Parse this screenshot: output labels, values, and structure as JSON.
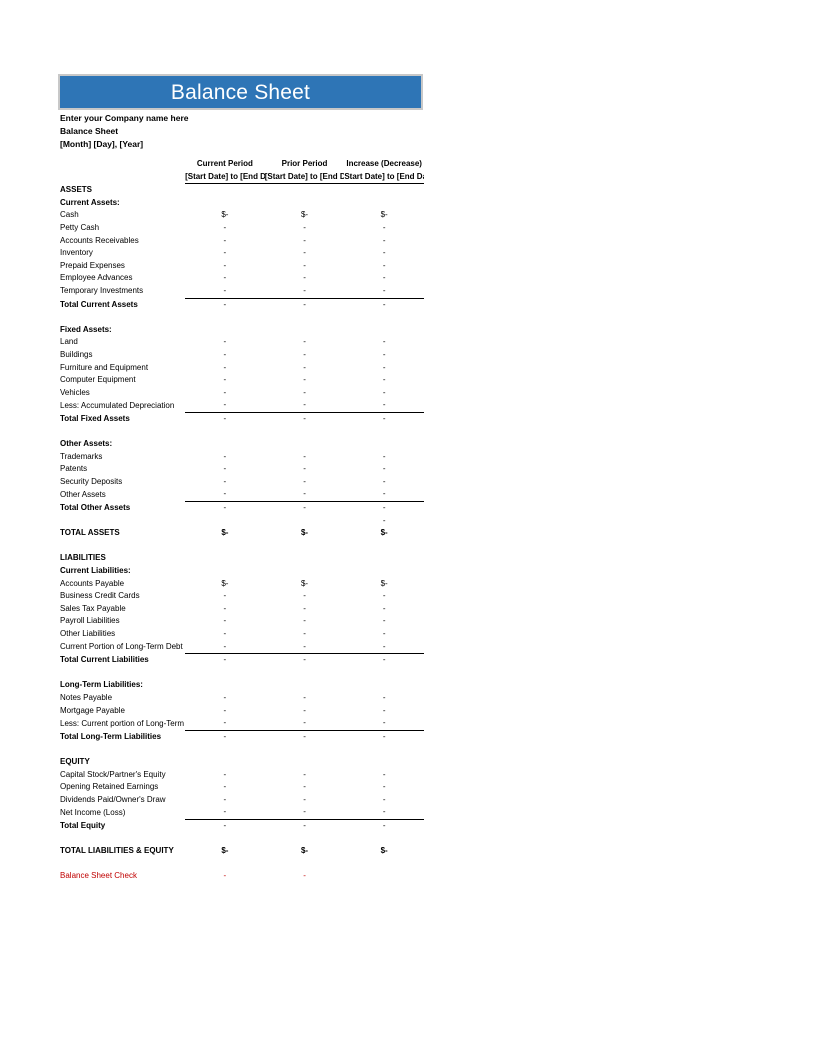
{
  "document": {
    "title": "Balance Sheet",
    "company_name": "Enter your Company name here",
    "doc_label": "Balance Sheet",
    "date_line": "[Month] [Day], [Year]"
  },
  "colors": {
    "banner_bg": "#2E75B6",
    "banner_border": "#c8c8c8",
    "banner_text": "#ffffff",
    "check_text": "#C00000"
  },
  "columns": [
    {
      "main": "Current Period",
      "sub": "[Start Date] to [End Date]"
    },
    {
      "main": "Prior Period",
      "sub": "[Start Date] to [End Date]"
    },
    {
      "main": "Increase (Decrease)",
      "sub": "Start Date] to [End Date]"
    }
  ],
  "sections": {
    "assets_heading": "ASSETS",
    "current_assets_heading": "Current Assets:",
    "fixed_assets_heading": "Fixed Assets:",
    "other_assets_heading": "Other Assets:",
    "liabilities_heading": "LIABILITIES",
    "current_liabilities_heading": "Current Liabilities:",
    "longterm_liabilities_heading": "Long-Term Liabilities:",
    "equity_heading": "EQUITY"
  },
  "rows": {
    "cash": {
      "label": "Cash",
      "v": [
        "$-",
        "$-",
        "$-"
      ]
    },
    "petty_cash": {
      "label": "Petty Cash",
      "v": [
        "-",
        "-",
        "-"
      ]
    },
    "accounts_recv": {
      "label": "Accounts Receivables",
      "v": [
        "-",
        "-",
        "-"
      ]
    },
    "inventory": {
      "label": "Inventory",
      "v": [
        "-",
        "-",
        "-"
      ]
    },
    "prepaid": {
      "label": "Prepaid Expenses",
      "v": [
        "-",
        "-",
        "-"
      ]
    },
    "emp_advances": {
      "label": "Employee Advances",
      "v": [
        "-",
        "-",
        "-"
      ]
    },
    "temp_invest": {
      "label": "Temporary Investments",
      "v": [
        "-",
        "-",
        "-"
      ]
    },
    "total_current_assets": {
      "label": "Total Current Assets",
      "v": [
        "-",
        "-",
        "-"
      ]
    },
    "land": {
      "label": "Land",
      "v": [
        "-",
        "-",
        "-"
      ]
    },
    "buildings": {
      "label": "Buildings",
      "v": [
        "-",
        "-",
        "-"
      ]
    },
    "furniture": {
      "label": "Furniture and Equipment",
      "v": [
        "-",
        "-",
        "-"
      ]
    },
    "computer_equip": {
      "label": "Computer Equipment",
      "v": [
        "-",
        "-",
        "-"
      ]
    },
    "vehicles": {
      "label": "Vehicles",
      "v": [
        "-",
        "-",
        "-"
      ]
    },
    "accum_depr": {
      "label": "Less: Accumulated Depreciation",
      "v": [
        "-",
        "-",
        "-"
      ]
    },
    "total_fixed_assets": {
      "label": "Total Fixed Assets",
      "v": [
        "-",
        "-",
        "-"
      ]
    },
    "trademarks": {
      "label": "Trademarks",
      "v": [
        "-",
        "-",
        "-"
      ]
    },
    "patents": {
      "label": "Patents",
      "v": [
        "-",
        "-",
        "-"
      ]
    },
    "security_dep": {
      "label": "Security Deposits",
      "v": [
        "-",
        "-",
        "-"
      ]
    },
    "other_assets": {
      "label": "Other Assets",
      "v": [
        "-",
        "-",
        "-"
      ]
    },
    "total_other_assets": {
      "label": "Total Other Assets",
      "v": [
        "-",
        "-",
        "-"
      ]
    },
    "stray_row": {
      "label": "",
      "v": [
        "",
        "",
        "-"
      ]
    },
    "total_assets": {
      "label": "TOTAL ASSETS",
      "v": [
        "$-",
        "$-",
        "$-"
      ]
    },
    "accounts_payable": {
      "label": "Accounts Payable",
      "v": [
        "$-",
        "$-",
        "$-"
      ]
    },
    "biz_credit_cards": {
      "label": "Business Credit Cards",
      "v": [
        "-",
        "-",
        "-"
      ]
    },
    "sales_tax": {
      "label": "Sales Tax Payable",
      "v": [
        "-",
        "-",
        "-"
      ]
    },
    "payroll_liab": {
      "label": "Payroll Liabilities",
      "v": [
        "-",
        "-",
        "-"
      ]
    },
    "other_liab": {
      "label": "Other Liabilities",
      "v": [
        "-",
        "-",
        "-"
      ]
    },
    "current_portion_lt": {
      "label": "Current Portion of Long-Term Debt",
      "v": [
        "-",
        "-",
        "-"
      ]
    },
    "total_current_liab": {
      "label": "Total Current Liabilities",
      "v": [
        "-",
        "-",
        "-"
      ]
    },
    "notes_payable": {
      "label": "Notes Payable",
      "v": [
        "-",
        "-",
        "-"
      ]
    },
    "mortgage_payable": {
      "label": "Mortgage Payable",
      "v": [
        "-",
        "-",
        "-"
      ]
    },
    "less_current_lt": {
      "label": "Less: Current portion of Long-Term Debt",
      "v": [
        "-",
        "-",
        "-"
      ]
    },
    "total_lt_liab": {
      "label": "Total Long-Term Liabilities",
      "v": [
        "-",
        "-",
        "-"
      ]
    },
    "capital_stock": {
      "label": "Capital Stock/Partner's Equity",
      "v": [
        "-",
        "-",
        "-"
      ]
    },
    "opening_retained": {
      "label": "Opening Retained Earnings",
      "v": [
        "-",
        "-",
        "-"
      ]
    },
    "dividends": {
      "label": "Dividends Paid/Owner's Draw",
      "v": [
        "-",
        "-",
        "-"
      ]
    },
    "net_income": {
      "label": "Net Income (Loss)",
      "v": [
        "-",
        "-",
        "-"
      ]
    },
    "total_equity": {
      "label": "Total Equity",
      "v": [
        "-",
        "-",
        "-"
      ]
    },
    "total_liab_equity": {
      "label": "TOTAL LIABILITIES & EQUITY",
      "v": [
        "$-",
        "$-",
        "$-"
      ]
    },
    "balance_check": {
      "label": "Balance Sheet Check",
      "v": [
        "-",
        "-",
        ""
      ]
    }
  }
}
